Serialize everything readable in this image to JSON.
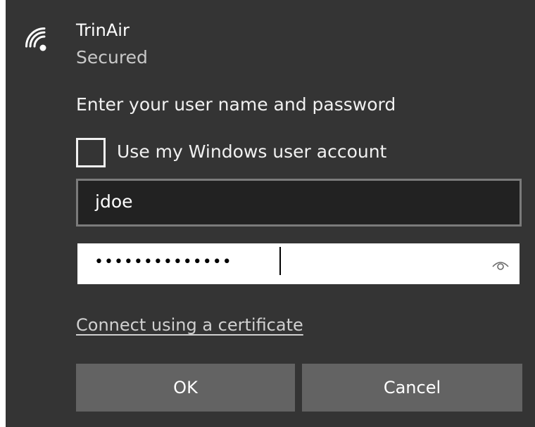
{
  "network": {
    "ssid": "TrinAir",
    "status": "Secured",
    "icon": "wifi-icon"
  },
  "credentials": {
    "prompt": "Enter your user name and password",
    "use_windows_account_label": "Use my Windows user account",
    "use_windows_account_checked": false,
    "username_value": "jdoe",
    "password_masked": "••••••••••••••",
    "reveal_icon": "eye-icon"
  },
  "link": {
    "certificate_label": "Connect using a certificate"
  },
  "buttons": {
    "ok_label": "OK",
    "cancel_label": "Cancel"
  },
  "colors": {
    "panel_bg": "#343434",
    "button_bg": "#636363",
    "input_dark_bg": "#222222"
  }
}
